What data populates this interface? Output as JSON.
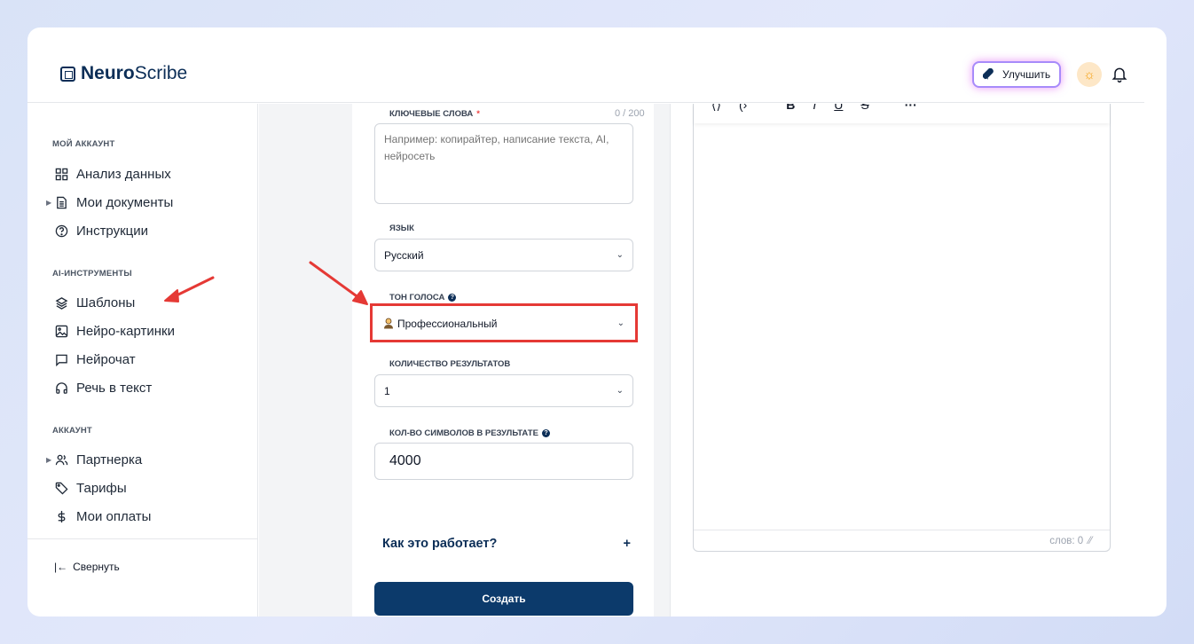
{
  "app": {
    "brand_bold": "Neuro",
    "brand_regular": "Scribe",
    "upgrade_label": "Улучшить"
  },
  "sidebar": {
    "section_account": "МОЙ АККАУНТ",
    "items_account": [
      {
        "label": "Анализ данных",
        "icon": "grid-icon"
      },
      {
        "label": "Мои документы",
        "icon": "document-icon"
      },
      {
        "label": "Инструкции",
        "icon": "help-circle-icon"
      }
    ],
    "section_ai": "AI-ИНСТРУМЕНТЫ",
    "items_ai": [
      {
        "label": "Шаблоны",
        "icon": "layers-icon"
      },
      {
        "label": "Нейро-картинки",
        "icon": "image-icon"
      },
      {
        "label": "Нейрочат",
        "icon": "chat-icon"
      },
      {
        "label": "Речь в текст",
        "icon": "headphones-icon"
      }
    ],
    "section_billing": "АККАУНТ",
    "items_billing": [
      {
        "label": "Партнерка",
        "icon": "users-icon"
      },
      {
        "label": "Тарифы",
        "icon": "tag-icon"
      },
      {
        "label": "Мои оплаты",
        "icon": "dollar-icon"
      }
    ],
    "collapse_label": "Свернуть",
    "collapse_glyph": "|←"
  },
  "form": {
    "keywords_label": "КЛЮЧЕВЫЕ СЛОВА",
    "keywords_required": "*",
    "keywords_counter": "0 / 200",
    "keywords_placeholder": "Например: копирайтер, написание текста, AI, нейросеть",
    "language_label": "ЯЗЫК",
    "language_value": "Русский",
    "tone_label": "ТОН ГОЛОСА",
    "tone_value": "Профессиональный",
    "results_label": "КОЛИЧЕСТВО РЕЗУЛЬТАТОВ",
    "results_value": "1",
    "chars_label": "КОЛ-ВО СИМВОЛОВ В РЕЗУЛЬТАТЕ",
    "chars_value": "4000",
    "howto_label": "Как это работает?",
    "howto_glyph": "+",
    "create_label": "Создать"
  },
  "editor": {
    "toolbar": [
      "⟨⟩",
      "(›",
      "B",
      "I",
      "U",
      "S",
      "···"
    ],
    "word_count": "слов: 0"
  },
  "colors": {
    "brand_navy": "#0c2e57",
    "annotation_red": "#e53935",
    "upgrade_glow": "#d946ef"
  }
}
